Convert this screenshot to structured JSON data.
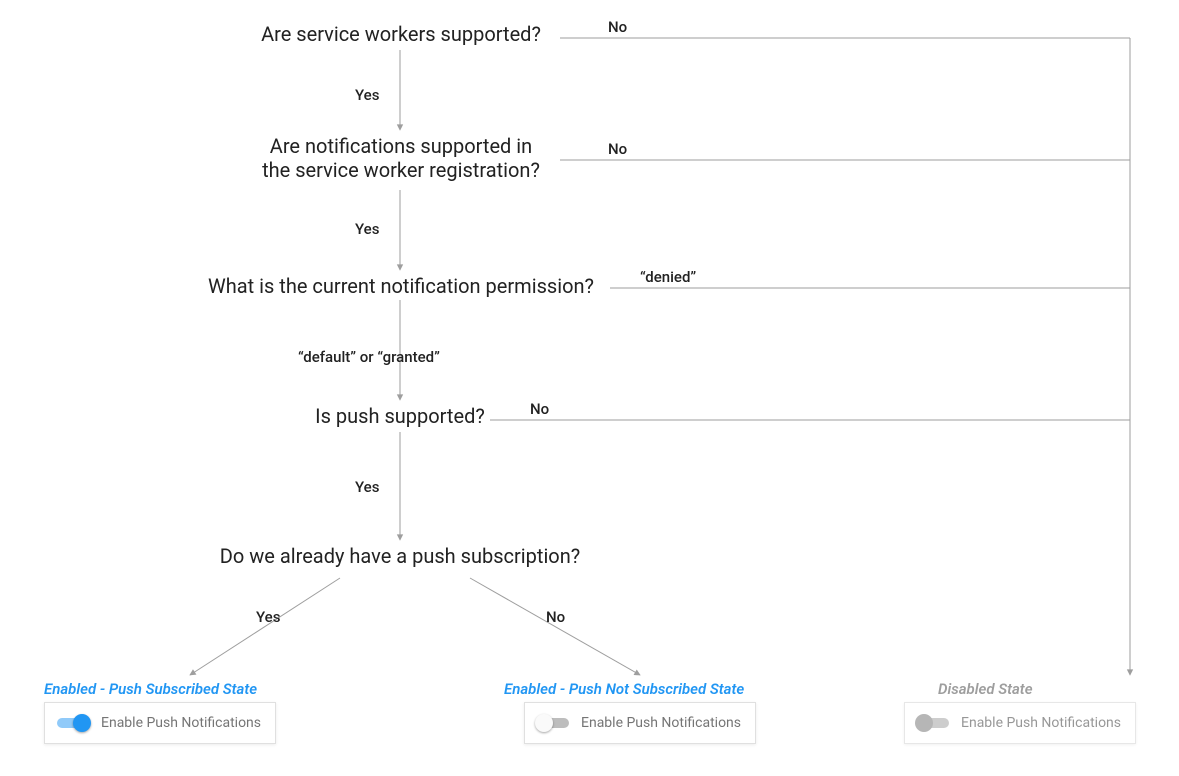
{
  "questions": {
    "q1": "Are service workers supported?",
    "q2": "Are notifications supported in\nthe service worker registration?",
    "q3": "What is the current notification permission?",
    "q4": "Is push supported?",
    "q5": "Do we already have a push subscription?"
  },
  "answers": {
    "yes": "Yes",
    "no": "No",
    "default_or_granted": "“default” or “granted”",
    "denied": "“denied”"
  },
  "states": {
    "subscribed": {
      "title": "Enabled - Push Subscribed State",
      "label": "Enable Push Notifications",
      "switch": "on"
    },
    "not_subscribed": {
      "title": "Enabled - Push Not Subscribed State",
      "label": "Enable Push Notifications",
      "switch": "off"
    },
    "disabled": {
      "title": "Disabled State",
      "label": "Enable Push Notifications",
      "switch": "disabled"
    }
  },
  "colors": {
    "text": "#222222",
    "accent": "#2196f3",
    "muted": "#9e9e9e",
    "line": "#9e9e9e"
  }
}
